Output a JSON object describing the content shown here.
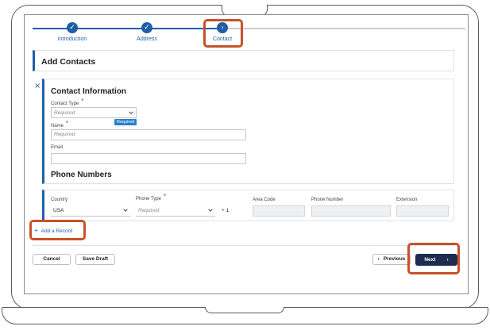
{
  "stepper": {
    "steps": [
      {
        "label": "Introduction",
        "state": "complete"
      },
      {
        "label": "Address",
        "state": "complete"
      },
      {
        "label": "Contact",
        "state": "current"
      }
    ]
  },
  "page": {
    "title": "Add Contacts"
  },
  "contact": {
    "section_title": "Contact Information",
    "contact_type_label": "Contact Type",
    "contact_type_placeholder": "Required",
    "required_tooltip": "Required",
    "name_label": "Name",
    "name_placeholder": "Required",
    "email_label": "Email",
    "phone_section_title": "Phone Numbers"
  },
  "phone": {
    "country_label": "Country",
    "country_value": "USA",
    "phone_type_label": "Phone Type",
    "phone_type_placeholder": "Required",
    "country_code": "+ 1",
    "area_code_label": "Area Code",
    "phone_number_label": "Phone Number",
    "extension_label": "Extension"
  },
  "actions": {
    "add_record": "Add a Record",
    "cancel": "Cancel",
    "save_draft": "Save Draft",
    "previous": "Previous",
    "next": "Next"
  },
  "colors": {
    "primary": "#1f5fa8",
    "highlight": "#c6522a",
    "required": "#d0312d",
    "next_button": "#1c2d4f"
  }
}
